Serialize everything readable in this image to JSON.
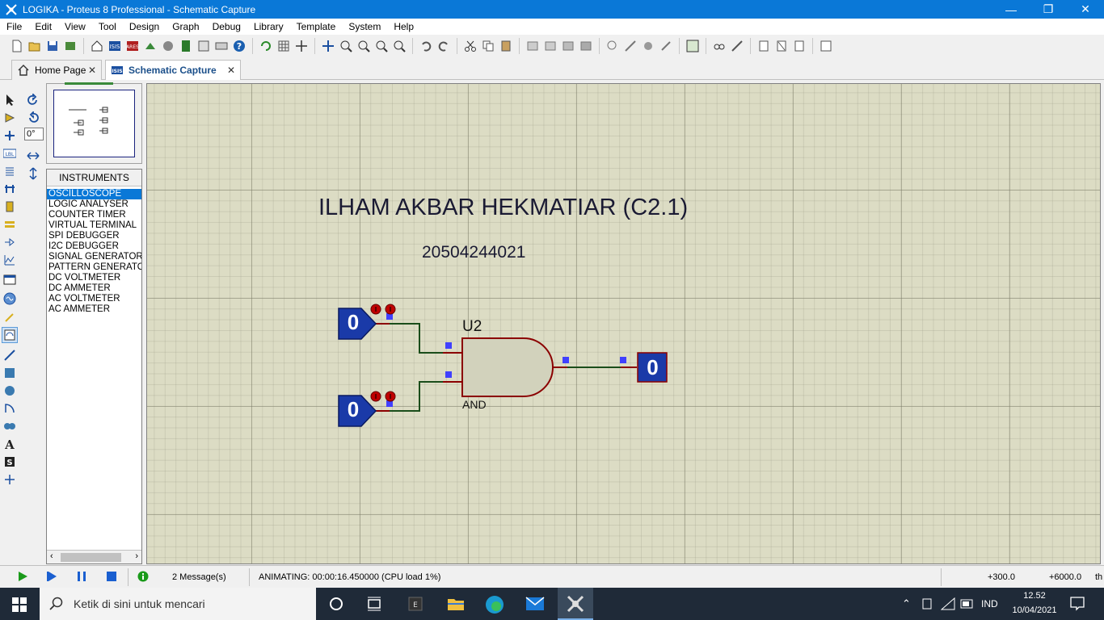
{
  "window": {
    "title": "LOGIKA - Proteus 8 Professional - Schematic Capture"
  },
  "menu": [
    "File",
    "Edit",
    "View",
    "Tool",
    "Design",
    "Graph",
    "Debug",
    "Library",
    "Template",
    "System",
    "Help"
  ],
  "tabs": [
    {
      "label": "Home Page",
      "close": "✕"
    },
    {
      "label": "Schematic Capture",
      "close": "✕"
    }
  ],
  "rotation": "0°",
  "instruments": {
    "header": "INSTRUMENTS",
    "items": [
      "OSCILLOSCOPE",
      "LOGIC ANALYSER",
      "COUNTER TIMER",
      "VIRTUAL TERMINAL",
      "SPI DEBUGGER",
      "I2C DEBUGGER",
      "SIGNAL GENERATOR",
      "PATTERN GENERATO",
      "DC VOLTMETER",
      "DC AMMETER",
      "AC VOLTMETER",
      "AC AMMETER"
    ]
  },
  "schematic": {
    "title_text": "ILHAM AKBAR HEKMATIAR (C2.1)",
    "id_text": "20504244021",
    "gate_ref": "U2",
    "gate_type": "AND",
    "input1_state": "0",
    "input2_state": "0",
    "output_state": "0",
    "colors": {
      "wire": "#1a4d1a",
      "pin_marker": "#4040ff",
      "logic_fill": "#1a3aa8",
      "gate_fill": "#d2d2bc",
      "gate_stroke": "#8b0000"
    }
  },
  "status": {
    "messages": "2 Message(s)",
    "animating": "ANIMATING: 00:00:16.450000 (CPU load 1%)",
    "coord_x": "+300.0",
    "coord_y": "+6000.0",
    "unit": "th"
  },
  "taskbar": {
    "search_placeholder": "Ketik di sini untuk mencari",
    "language": "IND",
    "time": "12.52",
    "date": "10/04/2021"
  }
}
